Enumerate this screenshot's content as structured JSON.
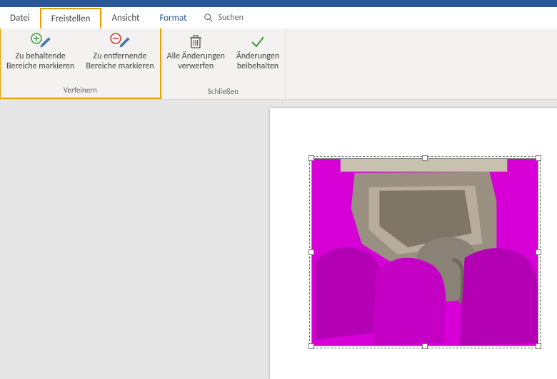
{
  "tabs": {
    "file": "Datei",
    "freistellen": "Freistellen",
    "ansicht": "Ansicht",
    "format": "Format",
    "search": "Suchen"
  },
  "ribbon": {
    "verfeinern": {
      "caption": "Verfeinern",
      "keep": "Zu behaltende\nBereiche markieren",
      "remove": "Zu entfernende\nBereiche markieren"
    },
    "schliessen": {
      "caption": "Schließen",
      "discard": "Alle Änderungen\nverwerfen",
      "keep": "Änderungen\nbeibehalten"
    }
  },
  "colors": {
    "accent": "#2b579a",
    "highlight_box": "#e5a100",
    "bg_removal": "#d600d6"
  },
  "image": {
    "description": "elephants-photo-with-magenta-background-removal-mask"
  }
}
